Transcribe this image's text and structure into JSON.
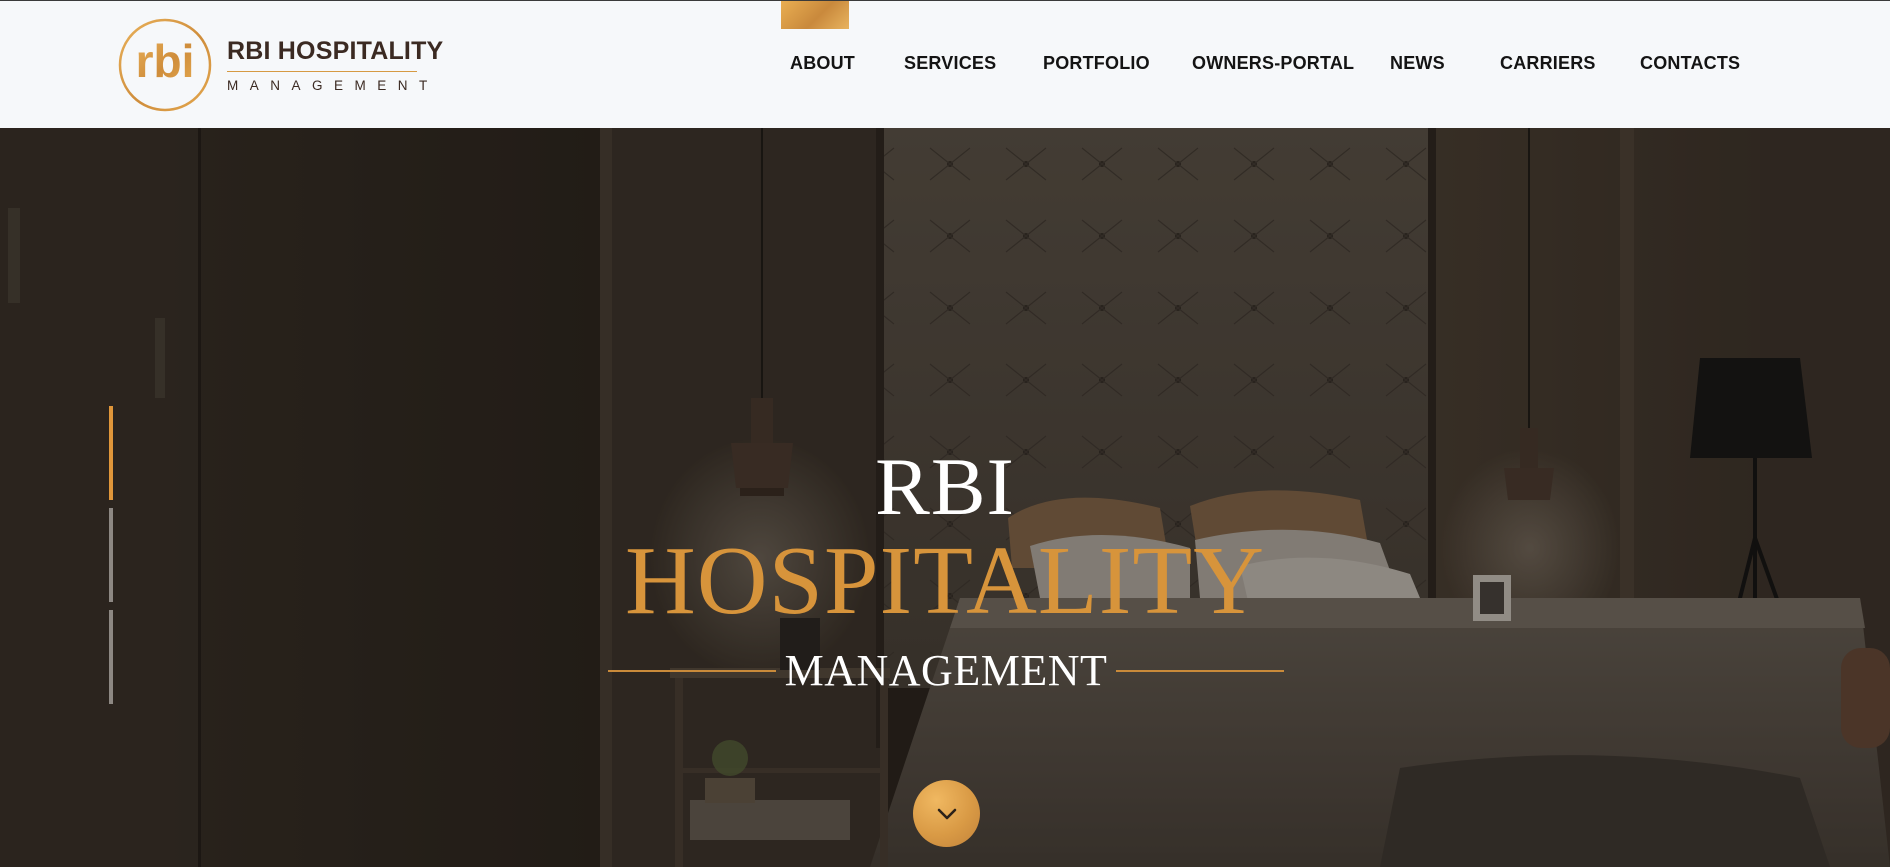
{
  "brand": {
    "title": "RBI HOSPITALITY",
    "subtitle": "MANAGEMENT",
    "mark": "rbi",
    "mark_icon": "rbi-monogram-logo",
    "accent_color": "#d7943b",
    "dark_color": "#3b2a22"
  },
  "nav": {
    "items": [
      {
        "label": "ABOUT"
      },
      {
        "label": "SERVICES"
      },
      {
        "label": "PORTFOLIO"
      },
      {
        "label": "OWNERS-PORTAL"
      },
      {
        "label": "NEWS"
      },
      {
        "label": "CARRIERS"
      },
      {
        "label": "CONTACTS"
      }
    ],
    "active": "ABOUT"
  },
  "hero": {
    "line1": "RBI",
    "line2": "HOSPITALITY",
    "line3": "MANAGEMENT",
    "background": "hotel-bedroom-photo",
    "slider": {
      "total": 3,
      "active_index": 0
    },
    "scroll_icon": "chevron-down-icon"
  }
}
